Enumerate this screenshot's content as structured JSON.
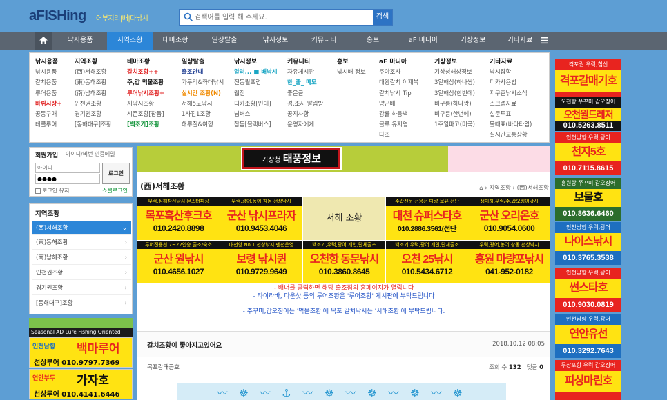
{
  "header": {
    "logo_text": "aFISHing",
    "tagline": "어부지리|배|다낚시",
    "search_placeholder": "검색어를 입력 해 주세요.",
    "search_button": "검색"
  },
  "nav": {
    "items": [
      "낚시용품",
      "지역조황",
      "테마조황",
      "일상탈출",
      "낚시정보",
      "커뮤니티",
      "홍보",
      "aF 마니아",
      "기상정보",
      "기타자료"
    ],
    "active": "지역조황"
  },
  "dropdown": {
    "columns": [
      {
        "title": "낚시용품",
        "items": [
          "낚시용품",
          "갈치용품",
          "루어용품",
          "바뤼시장+",
          "공동구매",
          "테클루어"
        ]
      },
      {
        "title": "지역조황",
        "items": [
          "(西)서해조황",
          "(東)동해조황",
          "(南)남해조황",
          "인천권조황",
          "경기권조황",
          "[동해대구]조황"
        ]
      },
      {
        "title": "테마조황",
        "items": [
          "갈치조황++",
          "주,갑 먹물조황",
          "루어낚시조황+",
          "지낚시조황",
          "시즌조황[참돔]",
          "[백조기]조황"
        ]
      },
      {
        "title": "일상탈출",
        "items": [
          "출조안내",
          "가두리&좌대낚시",
          "실시간 조황(N)",
          "서해5도낚시",
          "1사진1조황",
          "해루질&여행"
        ]
      },
      {
        "title": "낚시정보",
        "items": [
          "알려... ■ 배낚시",
          "전동릴포럼",
          "웹진",
          "디카조황[민대]",
          "넘버스",
          "참돔[블랙버스]"
        ]
      },
      {
        "title": "커뮤니티",
        "items": [
          "자유게시판",
          "한_줄_ 메모",
          "좋은글",
          "경,조사 알림방",
          "공지사항",
          "운영자에게"
        ]
      },
      {
        "title": "홍보",
        "items": [
          "낚시배 정보"
        ]
      },
      {
        "title": "aF 마니아",
        "items": [
          "주야조사",
          "대왕갈치 이재복",
          "갈치낚시 Tip",
          "양근배",
          "강룔 하웅백",
          "블루 유지영",
          "타조"
        ]
      },
      {
        "title": "기상정보",
        "items": [
          "기상청해상정보",
          "3일해상(하나쌍)",
          "3일해상(한번에)",
          "비구름(하나쌍)",
          "비구름(한번에)",
          "1주일파고(미국)"
        ]
      },
      {
        "title": "기타자료",
        "items": [
          "낚시잡학",
          "디카사용법",
          "지구촌낚시소식",
          "스크랩자료",
          "설문투표",
          "물때표(바다타임)",
          "실시간교통상황"
        ]
      }
    ]
  },
  "login": {
    "title": "회원가입",
    "find": "아이디/비번 인증메일",
    "id_placeholder": "아이디",
    "pw_value": "●●●●",
    "button": "로그인",
    "keep": "로그인 유지",
    "social": "쇼셜로그인"
  },
  "sidebar": {
    "title": "지역조황",
    "items": [
      "(西)서해조황",
      "(東)동해조황",
      "(南)남해조황",
      "인천권조황",
      "경기권조황",
      "[동해대구]조황"
    ],
    "active_index": 0
  },
  "left_ads": {
    "seasonal": "Seasonal AD Lure Fishing Oriented",
    "items": [
      {
        "area": "인천남항",
        "name": "백마루어",
        "phone": "선상루어 010.9797.7369"
      },
      {
        "area": "연안부두",
        "name": "가자호",
        "phone": "선상루어 010.4141.6446"
      }
    ]
  },
  "main": {
    "banner": {
      "prefix": "기상청",
      "title": "태풍정보"
    },
    "page_title": "(西)서해조황",
    "breadcrumb": "› 지역조황 › (西)서해조황",
    "center_label": "서해 조황",
    "ads": [
      {
        "top": "우럭,심해참선낚시 몬스터피싱",
        "name": "목포흑산후크호",
        "phone": "010.2420.8898"
      },
      {
        "top": "우럭,광어,농어,참돔 선상낚시",
        "name": "군산 낚시프라자",
        "phone": "010.9453.4046"
      },
      {
        "top": "주갑전문 전용선 다량 보유 선단",
        "name": "대천 슈퍼스타호",
        "phone": "010.2886.3561(선단"
      },
      {
        "top": "생미끼,우럭/주,갑오징어낚시",
        "name": "군산 오리온호",
        "phone": "010.9054.0600"
      },
      {
        "top": "루어전용선 7~22인승 출조/숙소",
        "name": "군산 원낚시",
        "phone": "010.4656.1027"
      },
      {
        "top": "대천항 No.1 선상낚시 펜션운영",
        "name": "보령 낚시퀸",
        "phone": "010.9729.9649"
      },
      {
        "top": "백조기,우럭,광어 개인,단체출조",
        "name": "오천항 동문낚시",
        "phone": "010.3860.8645"
      },
      {
        "top": "백조기,우럭,광어 개인,단체출조",
        "name": "오천 25낚시",
        "phone": "010.5434.6712"
      },
      {
        "top": "우럭,광어,농어,참돔 선상낚시",
        "name": "홍원 마량포낚시",
        "phone": "041-952-0182"
      }
    ],
    "notices": [
      "- 배너를 클릭하면 해당 출조점의 홈페이지가 열립니다",
      "- 타이라바, 다운샷 등의 루어조황은 '루어조황' 게시판에 부탁드립니다",
      "- 주꾸미,갑오징어는 '먹물조황'에 목포 갈치낚시는 '서해조황'에 부탁드립니다."
    ],
    "post": {
      "title": "갈치조황이 좋아지고있어요",
      "date": "2018.10.12 08:05",
      "author": "목포강태공호",
      "views_label": "조회 수",
      "views": "132",
      "comments_label": "댓글",
      "comments": "0"
    },
    "wave": "〰 ☸ 〰 ⚓ 〰 ☸ 〰 ☸ 〰 ☸ 〰 ☸"
  },
  "right_ads": [
    {
      "area": "격포권 우럭,침선",
      "name": "격포갈매기호",
      "phone": "010.3658.7854",
      "bg": "#e8241f",
      "name_bg": "#ffe312"
    },
    {
      "area": "오천항 쭈꾸미,갑오징어",
      "name": "오천월드레저",
      "phone": "010.5263.8511",
      "bg": "#141414",
      "name_bg": "#ffe312"
    },
    {
      "area": "인천남항 우럭,광어",
      "name": "천지5호",
      "phone": "010.7115.8615",
      "bg": "#e8241f",
      "name_bg": "#ffe312"
    },
    {
      "area": "홍원항 쭈꾸미,갑오징어",
      "name": "보물호",
      "phone": "010.8636.6460",
      "bg": "#2c6d2c",
      "name_bg": "#ffe312"
    },
    {
      "area": "인천남항 우럭,광어",
      "name": "나이스낚시",
      "phone": "010.3765.3538",
      "bg": "#1e6fc0",
      "name_bg": "#ffe312"
    },
    {
      "area": "인천남항 우럭,광어",
      "name": "썬스타호",
      "phone": "010.9030.0819",
      "bg": "#e8241f",
      "name_bg": "#ffe312"
    },
    {
      "area": "인천남항 우럭,광어",
      "name": "연안유선",
      "phone": "010.3292.7643",
      "bg": "#1e6fc0",
      "name_bg": "#ffe312"
    },
    {
      "area": "무창포항 우럭 갑오징어",
      "name": "피싱마린호",
      "phone": "",
      "bg": "#e8241f",
      "name_bg": "#ffe312"
    }
  ]
}
